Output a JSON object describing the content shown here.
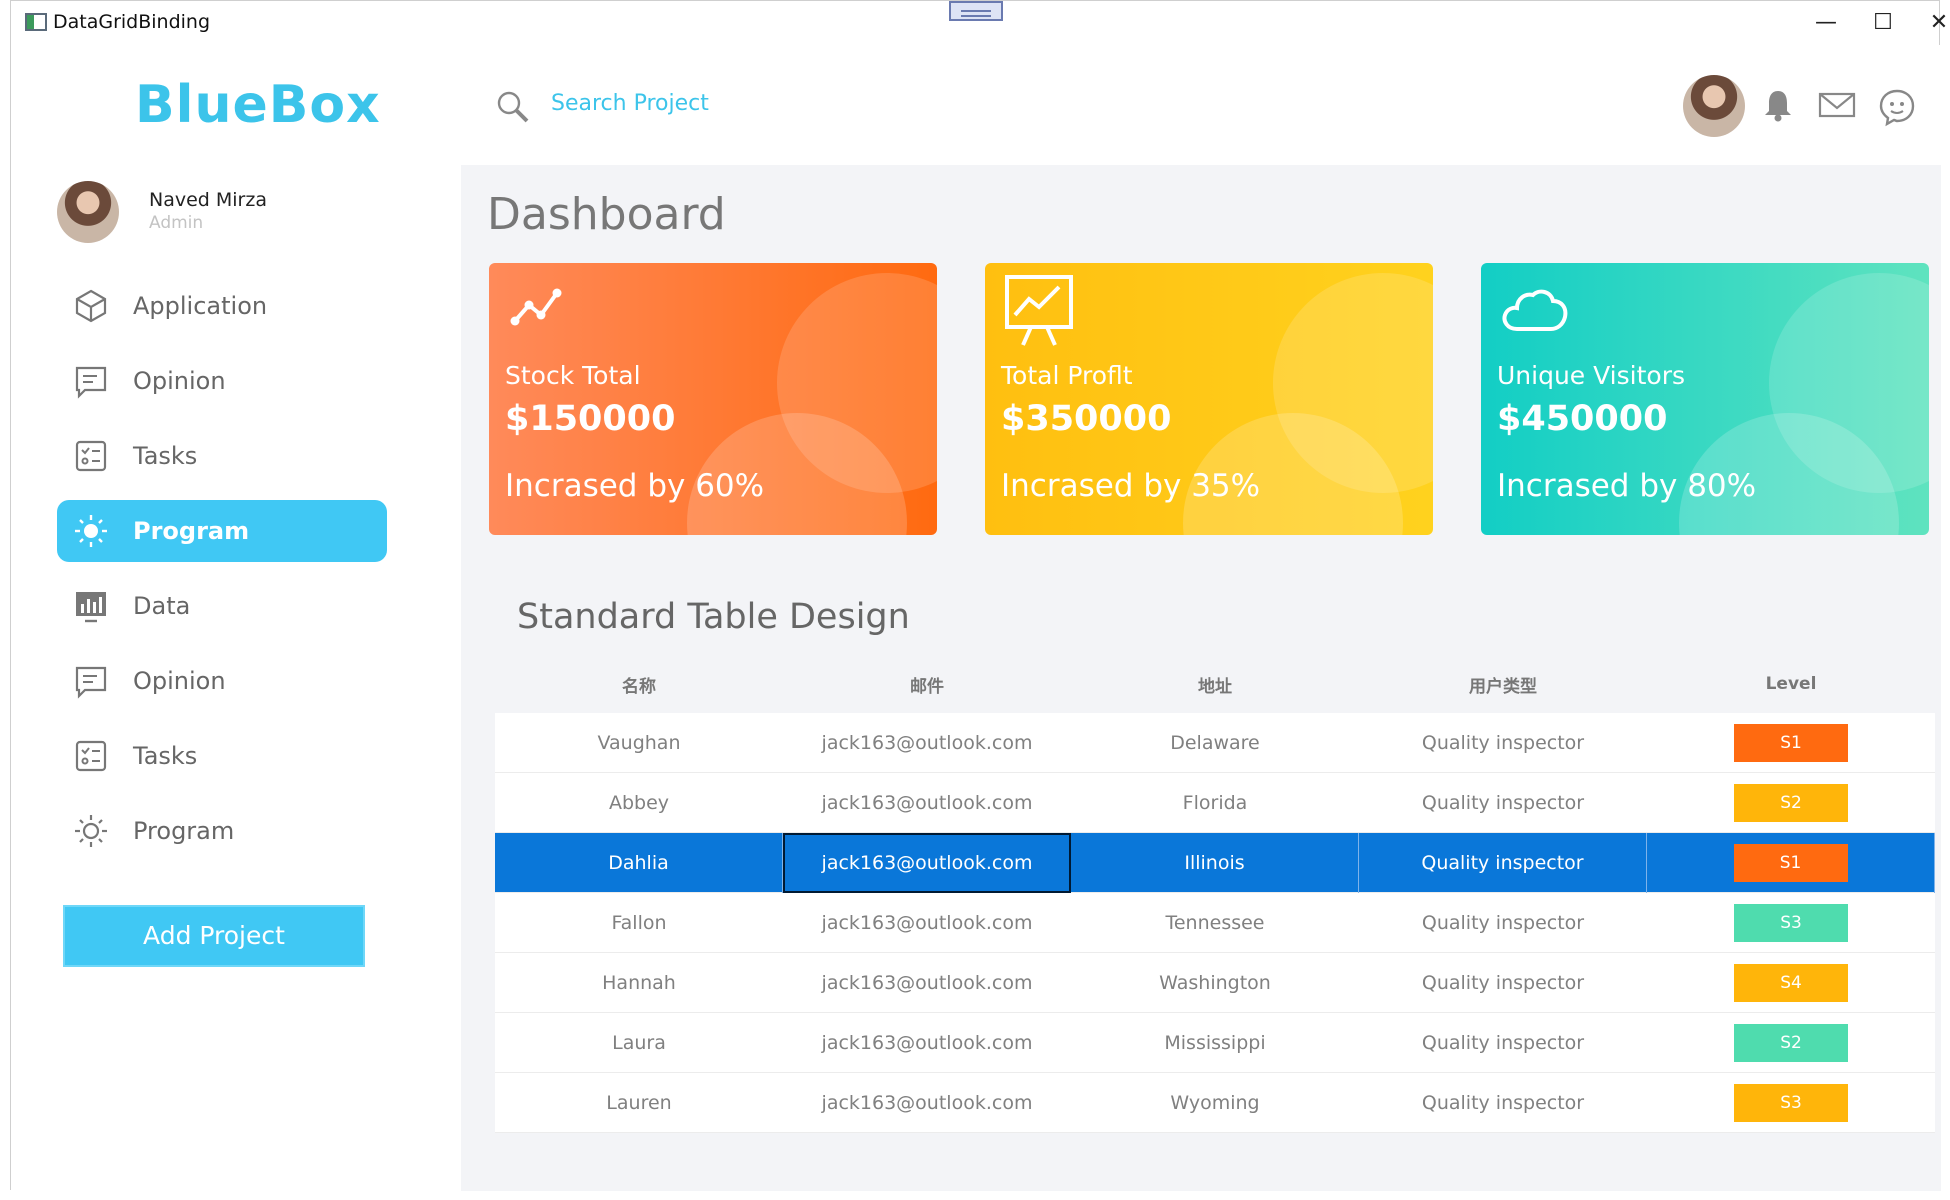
{
  "window": {
    "title": "DataGridBinding",
    "controls": {
      "minimize": "—",
      "maximize": "☐",
      "close": "✕"
    }
  },
  "sidebar": {
    "brand": "BlueBox",
    "profile": {
      "name": "Naved Mirza",
      "role": "Admin"
    },
    "items": [
      {
        "label": "Application",
        "icon": "cube-icon",
        "active": false
      },
      {
        "label": "Opinion",
        "icon": "message-icon",
        "active": false
      },
      {
        "label": "Tasks",
        "icon": "checklist-icon",
        "active": false
      },
      {
        "label": "Program",
        "icon": "sun-icon",
        "active": true
      },
      {
        "label": "Data",
        "icon": "bar-chart-icon",
        "active": false
      },
      {
        "label": "Opinion",
        "icon": "message-icon",
        "active": false
      },
      {
        "label": "Tasks",
        "icon": "checklist-icon",
        "active": false
      },
      {
        "label": "Program",
        "icon": "sun-icon",
        "active": false
      }
    ],
    "add_button": "Add Project"
  },
  "header": {
    "search_placeholder": "Search Project",
    "icons": [
      "avatar",
      "bell-icon",
      "mail-icon",
      "chat-icon"
    ]
  },
  "main": {
    "title": "Dashboard",
    "cards": [
      {
        "title": "Stock Total",
        "value": "$150000",
        "increase": "Incrased by 60%",
        "icon": "trend-icon",
        "gradient": [
          "#ff8a5a",
          "#ff6a10"
        ]
      },
      {
        "title": "Total Proflt",
        "value": "$350000",
        "increase": "Incrased by 35%",
        "icon": "presentation-chart-icon",
        "gradient": [
          "#ffbf10",
          "#ffd21e"
        ]
      },
      {
        "title": "Unique Visitors",
        "value": "$450000",
        "increase": "Incrased by 80%",
        "icon": "cloud-icon",
        "gradient": [
          "#12cec5",
          "#5fe3bf"
        ]
      }
    ],
    "table": {
      "title": "Standard Table Design",
      "headers": [
        "名称",
        "邮件",
        "地址",
        "用户类型",
        "Level"
      ],
      "rows": [
        {
          "name": "Vaughan",
          "email": "jack163@outlook.com",
          "address": "Delaware",
          "type": "Quality inspector",
          "level": "S1",
          "level_color": "#ff6a10",
          "selected": false
        },
        {
          "name": "Abbey",
          "email": "jack163@outlook.com",
          "address": "Florida",
          "type": "Quality inspector",
          "level": "S2",
          "level_color": "#ffb50a",
          "selected": false
        },
        {
          "name": "Dahlia",
          "email": "jack163@outlook.com",
          "address": "Illinois",
          "type": "Quality inspector",
          "level": "S1",
          "level_color": "#ff6a10",
          "selected": true
        },
        {
          "name": "Fallon",
          "email": "jack163@outlook.com",
          "address": "Tennessee",
          "type": "Quality inspector",
          "level": "S3",
          "level_color": "#4fdcae",
          "selected": false
        },
        {
          "name": "Hannah",
          "email": "jack163@outlook.com",
          "address": "Washington",
          "type": "Quality inspector",
          "level": "S4",
          "level_color": "#ffb50a",
          "selected": false
        },
        {
          "name": "Laura",
          "email": "jack163@outlook.com",
          "address": "Mississippi",
          "type": "Quality inspector",
          "level": "S2",
          "level_color": "#4fdcae",
          "selected": false
        },
        {
          "name": "Lauren",
          "email": "jack163@outlook.com",
          "address": "Wyoming",
          "type": "Quality inspector",
          "level": "S3",
          "level_color": "#ffb50a",
          "selected": false
        }
      ]
    }
  },
  "colors": {
    "accent": "#40c8f4",
    "brand": "#3cc4ea",
    "selection": "#0a77d9"
  }
}
